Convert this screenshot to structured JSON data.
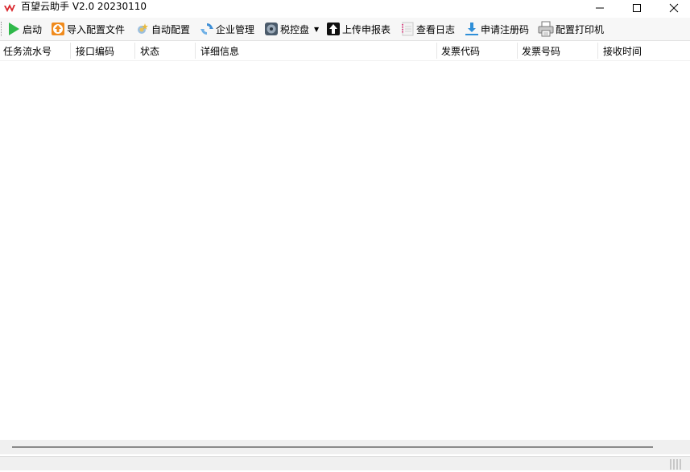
{
  "window": {
    "title": "百望云助手 V2.0  20230110",
    "controls": {
      "minimize": "minimize",
      "maximize": "maximize",
      "close": "close"
    }
  },
  "toolbar": {
    "items": [
      {
        "label": "启动",
        "icon": "play-icon"
      },
      {
        "label": "导入配置文件",
        "icon": "import-file-icon"
      },
      {
        "label": "自动配置",
        "icon": "wizard-icon"
      },
      {
        "label": "企业管理",
        "icon": "refresh-icon"
      },
      {
        "label": "税控盘",
        "icon": "disk-icon",
        "has_dropdown": true
      },
      {
        "label": "上传申报表",
        "icon": "upload-icon"
      },
      {
        "label": "查看日志",
        "icon": "notebook-icon"
      },
      {
        "label": "申请注册码",
        "icon": "download-icon"
      },
      {
        "label": "配置打印机",
        "icon": "printer-icon"
      }
    ]
  },
  "table": {
    "columns": [
      "任务流水号",
      "接口编码",
      "状态",
      "详细信息",
      "发票代码",
      "发票号码",
      "接收时间"
    ],
    "rows": []
  },
  "colors": {
    "logo_red": "#d9262c",
    "play_green": "#2fb84a",
    "import_orange": "#f08b1d",
    "refresh_blue": "#3f8fd6",
    "download_blue": "#2f8fd8"
  }
}
